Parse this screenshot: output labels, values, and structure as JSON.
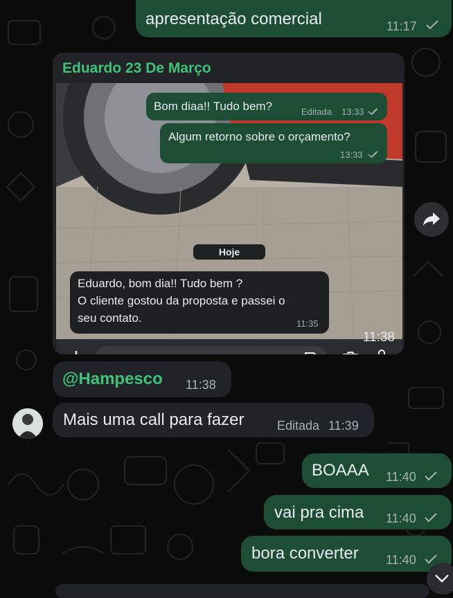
{
  "messages_top": {
    "text": "apresentação comercial",
    "time": "11:17"
  },
  "forwarded_card": {
    "sender": "Eduardo 23 De Março",
    "time": "11:38",
    "inner_chat": {
      "out_1": {
        "text": "Bom diaa!! Tudo bem?",
        "edited_label": "Editada",
        "time": "13:33"
      },
      "out_2": {
        "text": "Algum retorno sobre o orçamento?",
        "time": "13:33"
      },
      "divider": "Hoje",
      "in_1": {
        "lines": [
          "Eduardo, bom dia!! Tudo bem ?",
          "O cliente gostou da proposta e passei o",
          "seu contato."
        ],
        "time": "11:35"
      }
    }
  },
  "mention": {
    "handle": "@Hampesco",
    "time": "11:38"
  },
  "incoming": {
    "text": "Mais uma call para fazer",
    "edited_label": "Editada",
    "time": "11:39"
  },
  "outgoing": [
    {
      "text": "BOAAA",
      "time": "11:40"
    },
    {
      "text": "vai pra cima",
      "time": "11:40"
    },
    {
      "text": "bora converter",
      "time": "11:40"
    }
  ],
  "colors": {
    "background": "#0b0b0b",
    "outgoing_bubble": "#1e4d36",
    "incoming_bubble": "#202327",
    "sender_name": "#3fc378",
    "mention": "#3fc378"
  },
  "icons": {
    "read_receipt": "check-icon",
    "double_read_receipt": "double-check-icon",
    "forward": "forward-arrow-icon",
    "scroll_down": "chevron-down-icon",
    "add": "plus-icon",
    "sticker": "sticker-icon",
    "camera": "camera-icon",
    "microphone": "microphone-icon"
  }
}
